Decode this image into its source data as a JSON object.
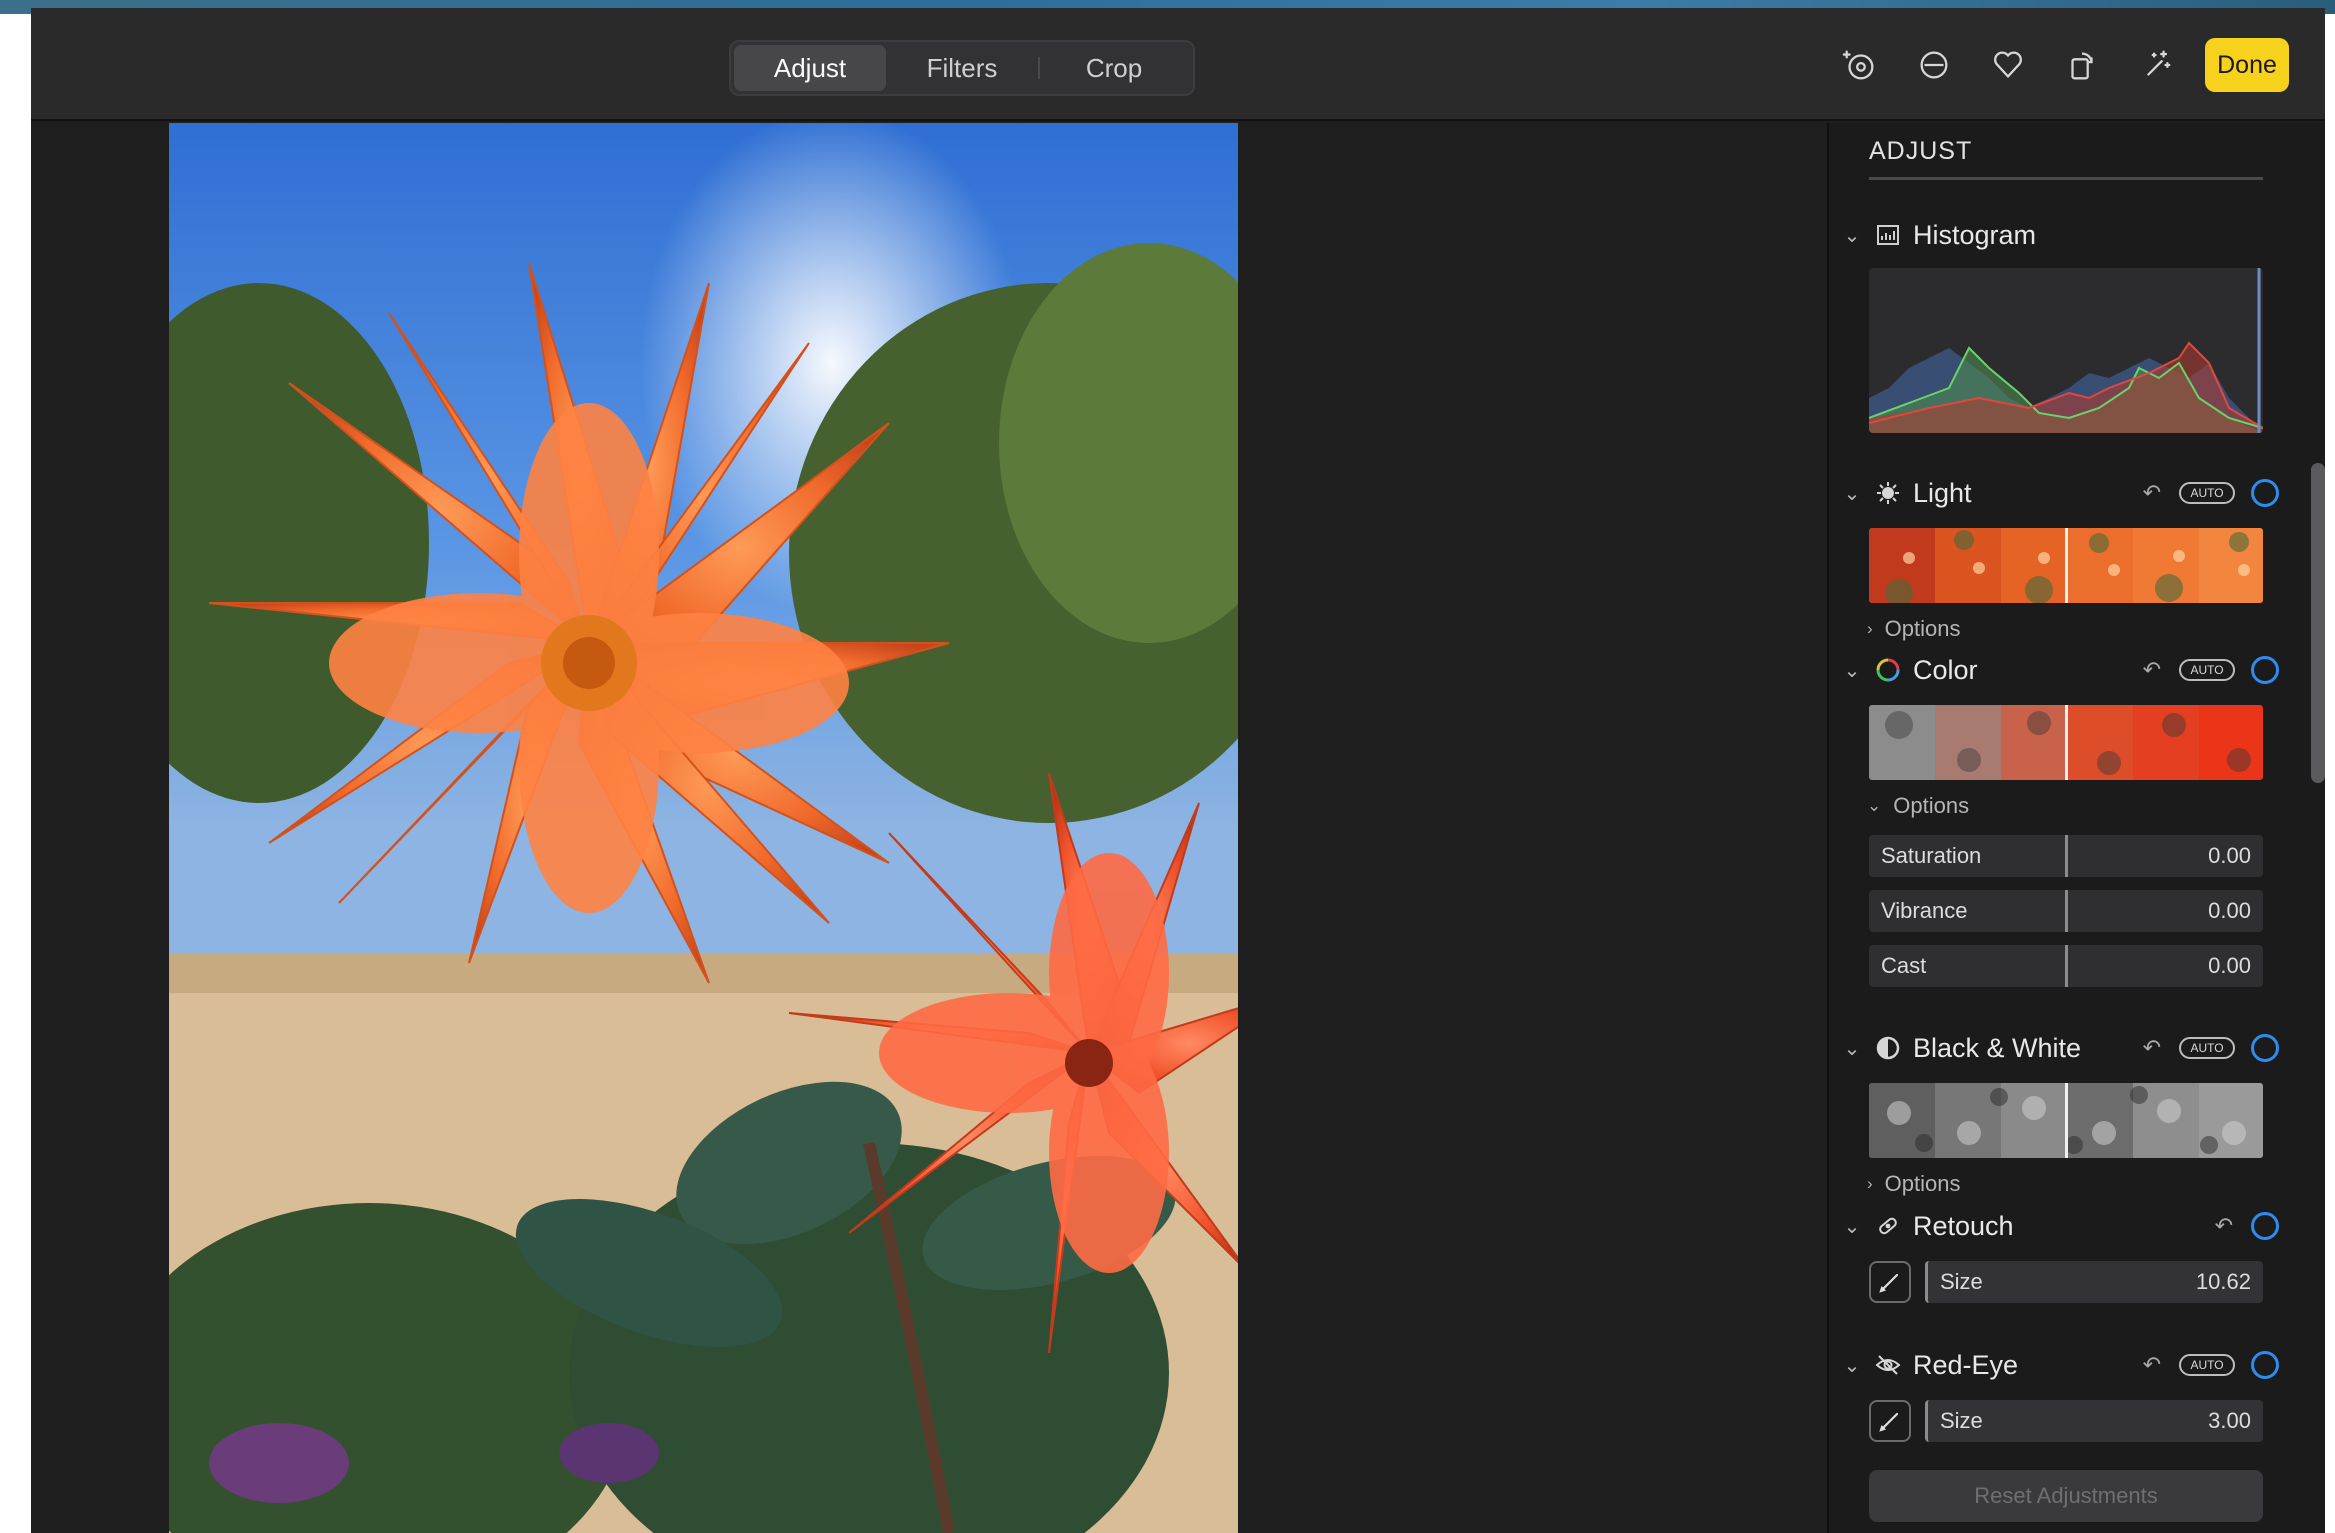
{
  "toolbar": {
    "tabs": [
      {
        "label": "Adjust",
        "active": true
      },
      {
        "label": "Filters",
        "active": false
      },
      {
        "label": "Crop",
        "active": false
      }
    ],
    "icons": [
      "info-icon",
      "rotate-icon",
      "favorite-heart-icon",
      "rotate-crop-icon",
      "magic-wand-icon"
    ],
    "done_label": "Done",
    "done_color": "#f6d21d"
  },
  "photo": {
    "subject": "orange dahlia flowers"
  },
  "sidebar": {
    "title": "ADJUST",
    "histogram": {
      "label": "Histogram"
    },
    "light": {
      "label": "Light",
      "auto": "AUTO",
      "options_label": "Options"
    },
    "color": {
      "label": "Color",
      "auto": "AUTO",
      "options_label": "Options",
      "sliders": [
        {
          "label": "Saturation",
          "value": "0.00"
        },
        {
          "label": "Vibrance",
          "value": "0.00"
        },
        {
          "label": "Cast",
          "value": "0.00"
        }
      ]
    },
    "bw": {
      "label": "Black & White",
      "auto": "AUTO",
      "options_label": "Options"
    },
    "retouch": {
      "label": "Retouch",
      "size_label": "Size",
      "size_value": "10.62"
    },
    "redeye": {
      "label": "Red-Eye",
      "auto": "AUTO",
      "size_label": "Size",
      "size_value": "3.00"
    },
    "reset_label": "Reset Adjustments",
    "accent_color": "#2d8cf0"
  }
}
